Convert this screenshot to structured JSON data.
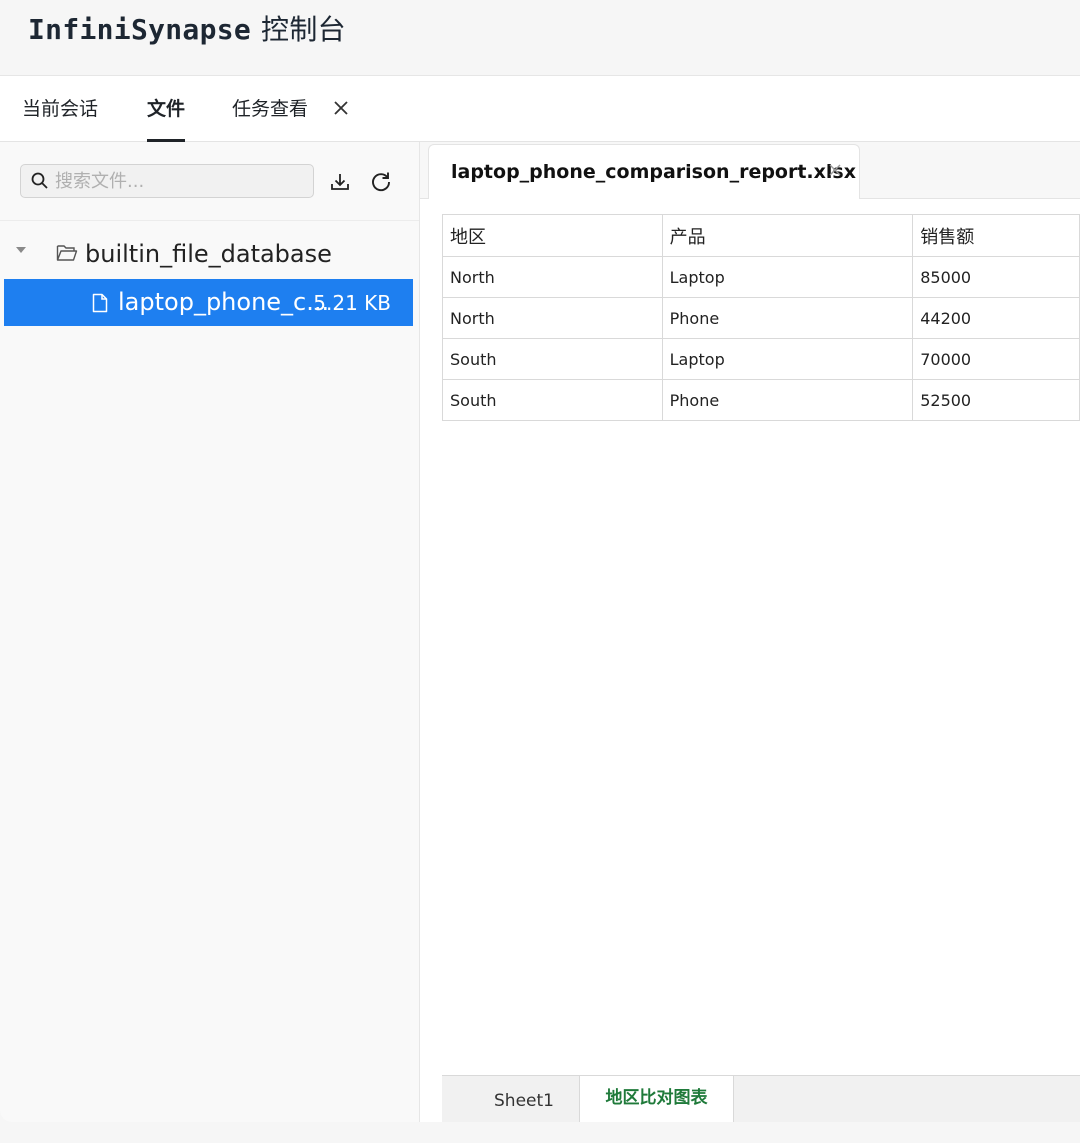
{
  "header": {
    "app_name": "InfiniSynapse",
    "app_suffix": "控制台"
  },
  "tabs": [
    {
      "label": "当前会话",
      "active": false
    },
    {
      "label": "文件",
      "active": true
    },
    {
      "label": "任务查看",
      "active": false
    }
  ],
  "sidebar": {
    "search_placeholder": "搜索文件...",
    "search_value": "",
    "folder": {
      "name": "builtin_file_database",
      "expanded": true
    },
    "files": [
      {
        "name": "laptop_phone_c...",
        "size": "5.21 KB",
        "selected": true
      }
    ]
  },
  "main": {
    "open_file": "laptop_phone_comparison_report.xlsx",
    "table": {
      "columns": [
        "地区",
        "产品",
        "销售额"
      ],
      "rows": [
        [
          "North",
          "Laptop",
          "85000"
        ],
        [
          "North",
          "Phone",
          "44200"
        ],
        [
          "South",
          "Laptop",
          "70000"
        ],
        [
          "South",
          "Phone",
          "52500"
        ]
      ]
    },
    "sheets": [
      {
        "name": "Sheet1",
        "active": false
      },
      {
        "name": "地区比对图表",
        "active": true
      }
    ]
  },
  "colors": {
    "accent": "#1e7ff0",
    "active_sheet": "#1f7a3a"
  }
}
